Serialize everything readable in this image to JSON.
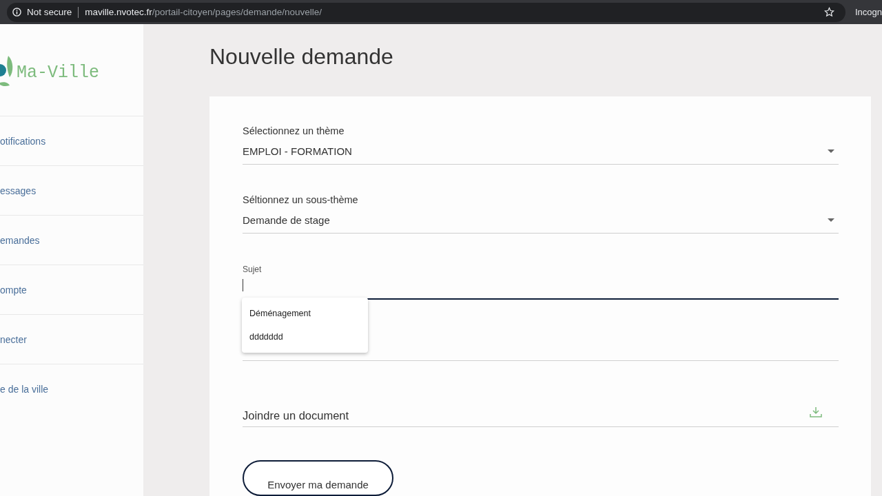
{
  "browser": {
    "security": "Not secure",
    "url_host": "maville.nvotec.fr",
    "url_path": "/portail-citoyen/pages/demande/nouvelle/",
    "profile": "Incogn"
  },
  "sidebar": {
    "logo": "Ma-Ville",
    "items": [
      {
        "label": "otifications"
      },
      {
        "label": "essages"
      },
      {
        "label": "emandes"
      },
      {
        "label": "ompte"
      },
      {
        "label": "necter"
      },
      {
        "label": "e de la ville"
      }
    ]
  },
  "page": {
    "title": "Nouvelle demande"
  },
  "form": {
    "fields": [
      {
        "kind": "select",
        "label": "Sélectionnez un thème",
        "value": "EMPLOI - FORMATION"
      },
      {
        "kind": "select",
        "label": "Séltionnez un sous-thème",
        "value": "Demande de stage"
      },
      {
        "kind": "text",
        "label": "Sujet",
        "focused": true,
        "suggestions": [
          "Déménagement",
          "ddddddd"
        ]
      },
      {
        "kind": "textarea",
        "focused": false
      },
      {
        "kind": "file",
        "label": "Joindre un document"
      }
    ],
    "submit": "Envoyer ma demande"
  }
}
